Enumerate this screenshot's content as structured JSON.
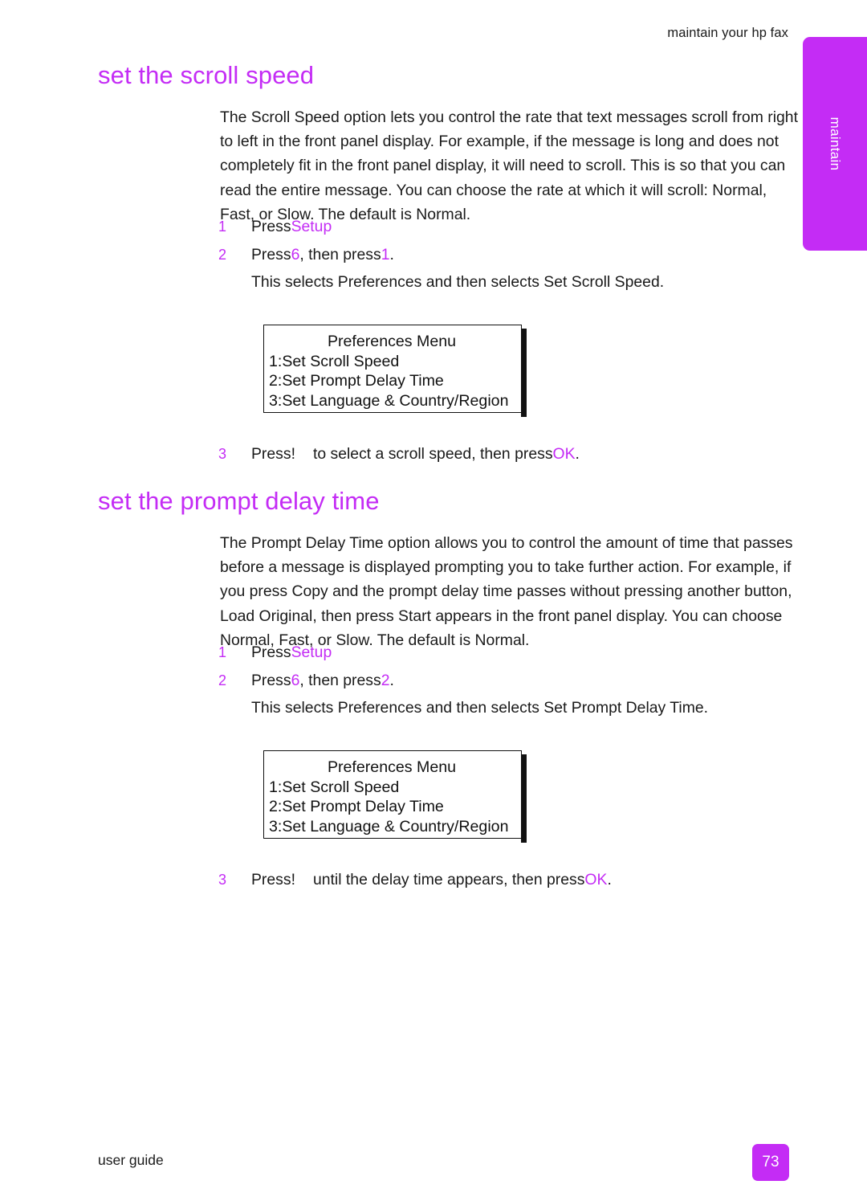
{
  "header": {
    "running_head": "maintain your hp fax"
  },
  "side_tab": {
    "label": "maintain",
    "color": "#C42CF5"
  },
  "sections": {
    "scroll_speed": {
      "heading": "set the scroll speed",
      "paragraph": "The Scroll Speed option lets you control the rate that text messages scroll from right to left in the front panel display. For example, if the message is long and does not completely fit in the front panel display, it will need to scroll. This is so that you can read the entire message. You can choose the rate at which it will scroll: Normal, Fast, or Slow. The default is Normal.",
      "steps": [
        {
          "number": "1",
          "text_before": "Press",
          "key": "Setup",
          "text_after": ""
        },
        {
          "number": "2",
          "text_before": "Press",
          "key": "6",
          "text_mid": ", then press",
          "key2": "1",
          "text_after": ".",
          "sub": "This selects Preferences and then selects Set Scroll Speed."
        },
        {
          "number": "3",
          "text_before": "Press!",
          "text_mid": "to select a scroll speed, then press",
          "key": "OK",
          "text_after": "."
        }
      ]
    },
    "prompt_delay": {
      "heading": "set the prompt delay time",
      "paragraph": "The Prompt Delay Time option allows you to control the amount of time that passes before a message is displayed prompting you to take further action. For example, if you press Copy and the prompt delay time passes without pressing another button,  Load Original, then press Start  appears in the front panel display. You can choose Normal, Fast, or Slow. The default is Normal.",
      "steps": [
        {
          "number": "1",
          "text_before": "Press",
          "key": "Setup",
          "text_after": ""
        },
        {
          "number": "2",
          "text_before": "Press",
          "key": "6",
          "text_mid": ", then press",
          "key2": "2",
          "text_after": ".",
          "sub": "This selects Preferences and then selects Set Prompt Delay Time."
        },
        {
          "number": "3",
          "text_before": "Press!",
          "text_mid": "until the delay time appears, then press",
          "key": "OK",
          "text_after": "."
        }
      ]
    }
  },
  "lcd_panel": {
    "title": "Preferences Menu",
    "lines": [
      "1:Set Scroll Speed",
      "2:Set Prompt Delay Time",
      "3:Set Language & Country/Region"
    ]
  },
  "footer": {
    "label": "user guide",
    "page_number": "73"
  }
}
